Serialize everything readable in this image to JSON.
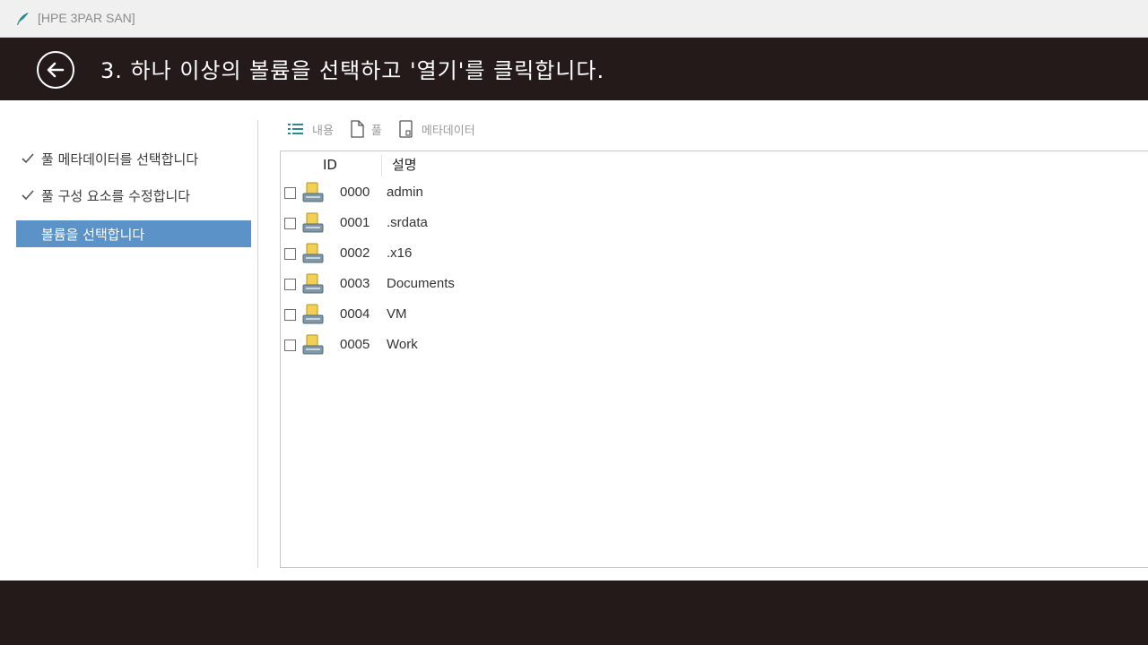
{
  "window": {
    "title": "[HPE 3PAR SAN]",
    "icon": "feather-icon"
  },
  "header": {
    "title": "3. 하나 이상의 볼륨을 선택하고 '열기'를 클릭합니다.",
    "back_icon": "back-arrow-icon"
  },
  "sidebar": {
    "steps": [
      {
        "label": "풀 메타데이터를 선택합니다",
        "state": "done"
      },
      {
        "label": "풀 구성 요소를 수정합니다",
        "state": "done"
      },
      {
        "label": "볼륨을 선택합니다",
        "state": "active"
      }
    ]
  },
  "toolbar": {
    "tabs": [
      {
        "label": "내용",
        "icon": "list-icon"
      },
      {
        "label": "풀",
        "icon": "document-icon"
      },
      {
        "label": "메타데이터",
        "icon": "metadata-icon"
      }
    ]
  },
  "table": {
    "columns": [
      "ID",
      "설명"
    ],
    "rows": [
      {
        "id": "0000",
        "description": "admin",
        "checked": false
      },
      {
        "id": "0001",
        "description": ".srdata",
        "checked": false
      },
      {
        "id": "0002",
        "description": ".x16",
        "checked": false
      },
      {
        "id": "0003",
        "description": "Documents",
        "checked": false
      },
      {
        "id": "0004",
        "description": "VM",
        "checked": false
      },
      {
        "id": "0005",
        "description": "Work",
        "checked": false
      }
    ]
  },
  "colors": {
    "header_bg": "#231a19",
    "active_step": "#5b92c8",
    "accent_icon": "#2a8c8c"
  }
}
